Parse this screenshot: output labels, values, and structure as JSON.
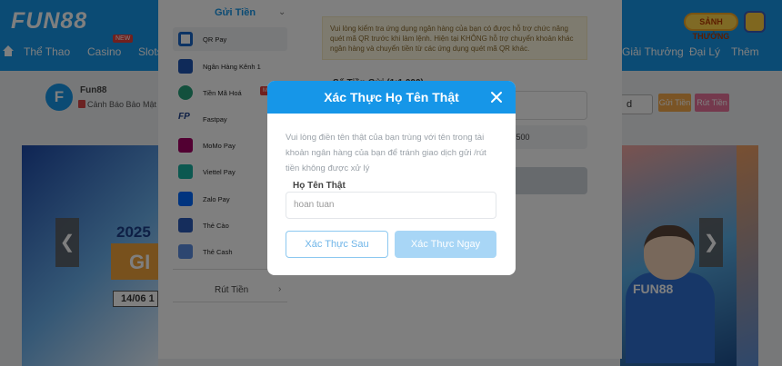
{
  "header": {
    "logo": "FUN88",
    "nav": [
      "Thể Thao",
      "Casino",
      "Slots",
      "Giải Thưởng",
      "Đại Lý",
      "Thêm"
    ],
    "new_badge": "NEW",
    "rank_button": "SẢNH THƯỞNG"
  },
  "profile": {
    "avatar_letter": "F",
    "name": "Fun88",
    "warning": "Cảnh Báo Bảo Mật",
    "currency_select": "d",
    "deposit_button": "Gửi Tiền",
    "withdraw_button": "Rút Tiền"
  },
  "banner": {
    "year": "2025",
    "big": "GI",
    "date": "14/06 1",
    "jersey": "FUN88"
  },
  "deposit": {
    "section_title": "Gửi Tiền",
    "methods": [
      "QR Pay",
      "Ngân Hàng Kênh 1",
      "Tiền Mã Hoá",
      "Fastpay",
      "MoMo Pay",
      "Viettel Pay",
      "Zalo Pay",
      "Thẻ Cào",
      "Thẻ Cash"
    ],
    "new_tag": "Mới",
    "withdraw_title": "Rút Tiền",
    "notice": "Vui lòng kiểm tra ứng dụng ngân hàng của bạn có được hỗ trợ chức năng quét mã QR trước khi làm lệnh. Hiện tại KHÔNG hỗ trợ chuyển khoản khác ngân hàng và chuyển tiền từ các ứng dụng quét mã QR khác.",
    "amount_label": "Số Tiền Gửi (1:1,000)",
    "amount_hint": "n 500"
  },
  "modal": {
    "title": "Xác Thực Họ Tên Thật",
    "description": "Vui lòng điền tên thật của bạn trùng với tên trong tài khoản ngân hàng của bạn để tránh giao dịch gửi /rút tiền không được xử lý",
    "field_label": "Họ Tên Thật",
    "field_value": "hoan tuan",
    "later_button": "Xác Thực Sau",
    "confirm_button": "Xác Thực Ngay"
  }
}
